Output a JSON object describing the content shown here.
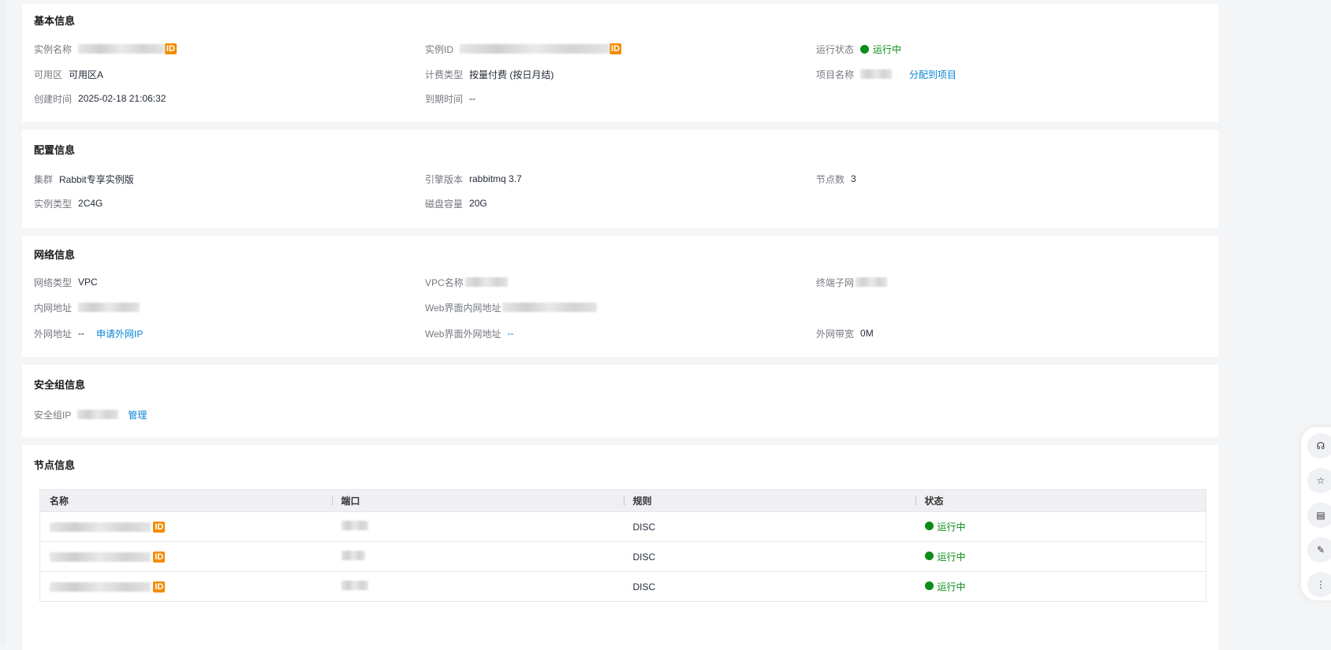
{
  "basic": {
    "title": "基本信息",
    "instance_name_label": "实例名称",
    "id_badge": "ID",
    "instance_id_label": "实例ID",
    "status_label": "运行状态",
    "status_value": "运行中",
    "zone_label": "可用区",
    "zone_value": "可用区A",
    "billing_label": "计费类型",
    "billing_value": "按量付费 (按日月结)",
    "project_label": "项目名称",
    "assign_project": "分配到项目",
    "created_label": "创建时间",
    "created_value": "2025-02-18 21:06:32",
    "expire_label": "到期时间",
    "expire_value": "--"
  },
  "config": {
    "title": "配置信息",
    "cluster_label": "集群",
    "cluster_value": "Rabbit专享实例版",
    "engine_label": "引擎版本",
    "engine_value": "rabbitmq 3.7",
    "nodes_label": "节点数",
    "nodes_value": "3",
    "type_label": "实例类型",
    "type_value": "2C4G",
    "disk_label": "磁盘容量",
    "disk_value": "20G"
  },
  "network": {
    "title": "网络信息",
    "net_type_label": "网络类型",
    "net_type_value": "VPC",
    "vpc_label": "VPC名称",
    "subnet_label": "终端子网",
    "private_label": "内网地址",
    "web_private_label": "Web界面内网地址",
    "public_label": "外网地址",
    "public_value": "--",
    "apply_public": "申请外网IP",
    "web_public_label": "Web界面外网地址",
    "web_public_value": "--",
    "bandwidth_label": "外网带宽",
    "bandwidth_value": "0M"
  },
  "security": {
    "title": "安全组信息",
    "sg_label": "安全组IP",
    "manage": "管理"
  },
  "nodes": {
    "title": "节点信息",
    "columns": [
      "名称",
      "端口",
      "规则",
      "状态"
    ],
    "rows": [
      {
        "id_badge": "ID",
        "rule": "DISC",
        "status": "运行中"
      },
      {
        "id_badge": "ID",
        "rule": "DISC",
        "status": "运行中"
      },
      {
        "id_badge": "ID",
        "rule": "DISC",
        "status": "运行中"
      }
    ]
  },
  "colors": {
    "accent": "#0a84d6",
    "running": "#0b8c18",
    "badge": "#f28b00"
  }
}
